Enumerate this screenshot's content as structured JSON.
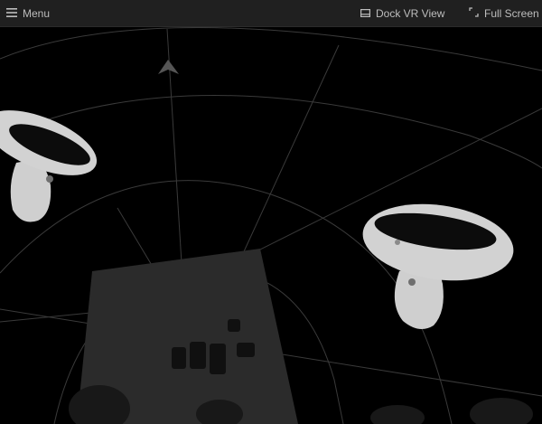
{
  "toolbar": {
    "menu_label": "Menu",
    "dock_label": "Dock VR View",
    "fullscreen_label": "Full Screen"
  },
  "icons": {
    "menu": "hamburger-icon",
    "dock": "dock-window-icon",
    "fullscreen": "fullscreen-expand-icon",
    "heading": "direction-arrow-icon"
  },
  "colors": {
    "toolbar_bg": "#202020",
    "toolbar_text": "#bdbdbd",
    "viewport_bg": "#000000",
    "controller": "#d8d8d8"
  }
}
